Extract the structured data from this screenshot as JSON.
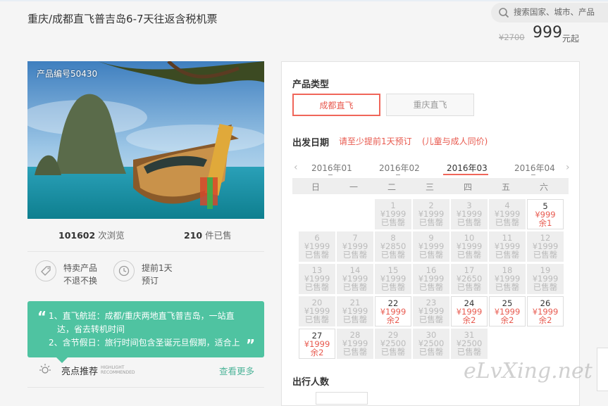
{
  "page": {
    "title": "重庆/成都直飞普吉岛6-7天往返含税机票",
    "search_placeholder": "搜索国家、城市、产品",
    "old_price": "¥2700",
    "price": "999",
    "price_unit": "元起"
  },
  "product": {
    "code": "产品编号50430",
    "views_num": "101602",
    "views_label": "次浏览",
    "sold_num": "210",
    "sold_label": "件已售",
    "features": [
      {
        "icon": "tag-icon",
        "line1": "特卖产品",
        "line2": "不退不换"
      },
      {
        "icon": "clock-icon",
        "line1": "提前1天",
        "line2": "预订"
      }
    ],
    "highlight_lines": [
      "1、直飞航班：成都/重庆两地直飞普吉岛，一站直",
      "达，省去转机时间",
      "2、含节假日：旅行时间包含圣诞元旦假期，适合上"
    ],
    "highlight_label": "亮点推荐",
    "highlight_en_1": "HIGHLIGHT",
    "highlight_en_2": "RECOMMENDED",
    "more_link": "查看更多"
  },
  "booking": {
    "type_label": "产品类型",
    "types": [
      "成都直飞",
      "重庆直飞"
    ],
    "date_label": "出发日期",
    "note1": "请至少提前1天预订",
    "note2": "(儿童与成人同价)",
    "months": [
      "2016年01",
      "2016年02",
      "2016年03",
      "2016年04"
    ],
    "weekdays": [
      "日",
      "一",
      "二",
      "三",
      "四",
      "五",
      "六"
    ],
    "people_label": "出行人数",
    "days": [
      {
        "d": "1",
        "p": "¥1999",
        "s": "已售罄",
        "av": false
      },
      {
        "d": "2",
        "p": "¥1999",
        "s": "已售罄",
        "av": false
      },
      {
        "d": "3",
        "p": "¥1999",
        "s": "已售罄",
        "av": false
      },
      {
        "d": "4",
        "p": "¥1999",
        "s": "已售罄",
        "av": false
      },
      {
        "d": "5",
        "p": "¥999",
        "s": "余1",
        "av": true
      },
      {
        "d": "6",
        "p": "¥1999",
        "s": "已售罄",
        "av": false
      },
      {
        "d": "7",
        "p": "¥1999",
        "s": "已售罄",
        "av": false
      },
      {
        "d": "8",
        "p": "¥2850",
        "s": "已售罄",
        "av": false
      },
      {
        "d": "9",
        "p": "¥1999",
        "s": "已售罄",
        "av": false
      },
      {
        "d": "10",
        "p": "¥1999",
        "s": "已售罄",
        "av": false
      },
      {
        "d": "11",
        "p": "¥1999",
        "s": "已售罄",
        "av": false
      },
      {
        "d": "12",
        "p": "¥1999",
        "s": "已售罄",
        "av": false
      },
      {
        "d": "13",
        "p": "¥1999",
        "s": "已售罄",
        "av": false
      },
      {
        "d": "14",
        "p": "¥1999",
        "s": "已售罄",
        "av": false
      },
      {
        "d": "15",
        "p": "¥1999",
        "s": "已售罄",
        "av": false
      },
      {
        "d": "16",
        "p": "¥1999",
        "s": "已售罄",
        "av": false
      },
      {
        "d": "17",
        "p": "¥2650",
        "s": "已售罄",
        "av": false
      },
      {
        "d": "18",
        "p": "¥1999",
        "s": "已售罄",
        "av": false
      },
      {
        "d": "19",
        "p": "¥1999",
        "s": "已售罄",
        "av": false
      },
      {
        "d": "20",
        "p": "¥1999",
        "s": "已售罄",
        "av": false
      },
      {
        "d": "21",
        "p": "¥1999",
        "s": "已售罄",
        "av": false
      },
      {
        "d": "22",
        "p": "¥1999",
        "s": "余2",
        "av": true
      },
      {
        "d": "23",
        "p": "¥1999",
        "s": "已售罄",
        "av": false
      },
      {
        "d": "24",
        "p": "¥1999",
        "s": "余2",
        "av": true
      },
      {
        "d": "25",
        "p": "¥1999",
        "s": "余2",
        "av": true
      },
      {
        "d": "26",
        "p": "¥1999",
        "s": "余2",
        "av": true
      },
      {
        "d": "27",
        "p": "¥1999",
        "s": "余2",
        "av": true
      },
      {
        "d": "28",
        "p": "¥1999",
        "s": "已售罄",
        "av": false
      },
      {
        "d": "29",
        "p": "¥2500",
        "s": "已售罄",
        "av": false
      },
      {
        "d": "30",
        "p": "¥2500",
        "s": "已售罄",
        "av": false
      },
      {
        "d": "31",
        "p": "¥2500",
        "s": "已售罄",
        "av": false
      }
    ]
  },
  "watermark": "eLvXing.net",
  "colors": {
    "accent": "#e85a4f",
    "highlight": "#4fc3a1",
    "link": "#4fb59a"
  }
}
